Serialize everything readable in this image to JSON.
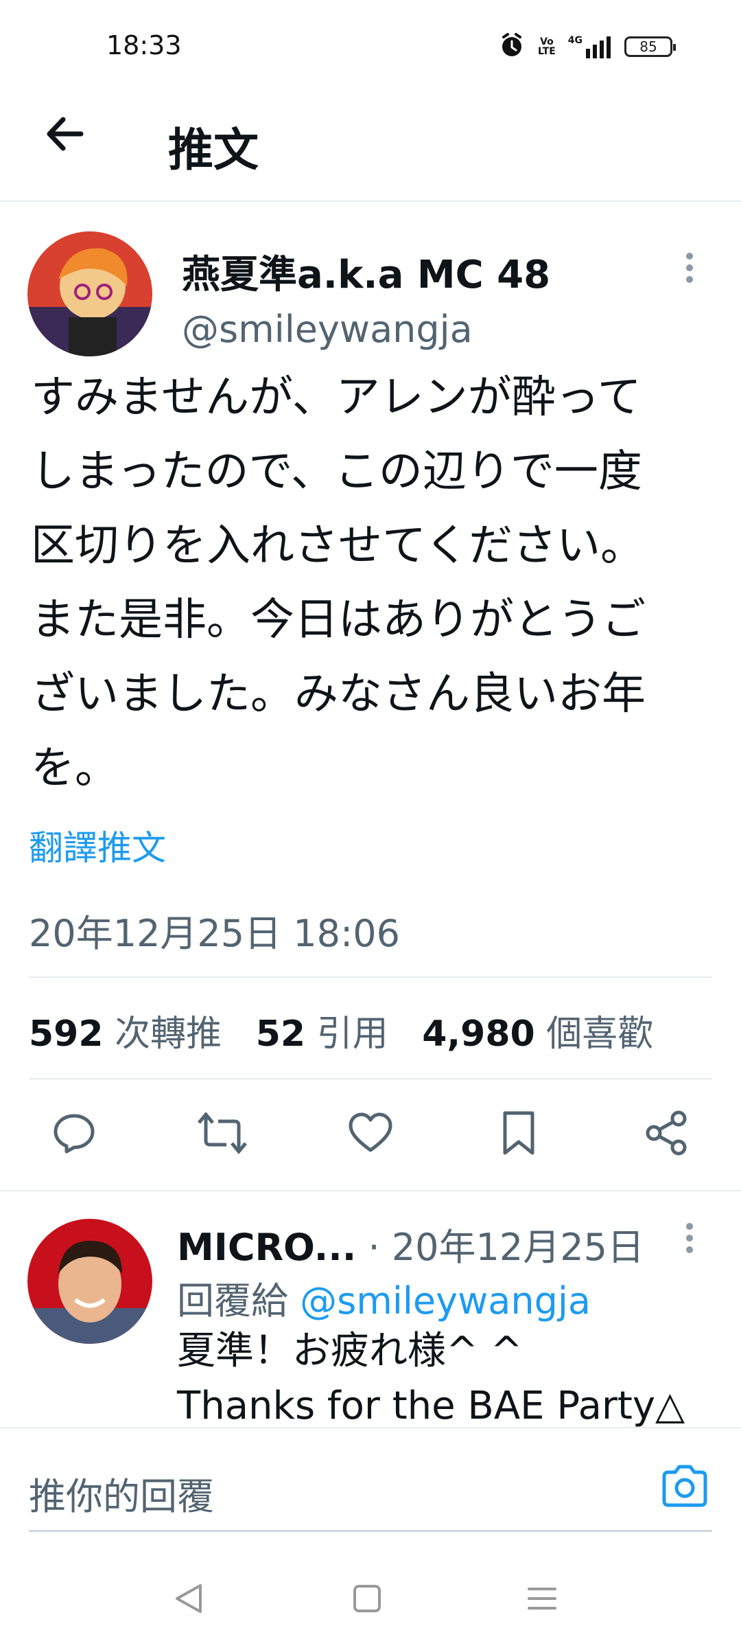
{
  "status_bar": {
    "time": "18:33",
    "battery": "85",
    "network": "4G",
    "volte_top": "Vo",
    "volte_bottom": "LTE"
  },
  "header": {
    "title": "推文"
  },
  "tweet": {
    "author_name": "燕夏準a.k.a MC 48",
    "handle": "@smileywangja",
    "text_lines": [
      "すみませんが、アレンが酔って",
      "しまったので、この辺りで一度",
      "区切りを入れさせてください。",
      "また是非。今日はありがとうご",
      "ざいました。みなさん良いお年",
      "を。"
    ],
    "translate_link": "翻譯推文",
    "timestamp": "20年12月25日 18:06",
    "stats": {
      "retweets_count": "592",
      "retweets_label": "次轉推",
      "quotes_count": "52",
      "quotes_label": "引用",
      "likes_count": "4,980",
      "likes_label": "個喜歡"
    }
  },
  "reply": {
    "author_name": "MICRO...",
    "date": "· 20年12月25日",
    "replying_to_label": "回覆給",
    "replying_to_handle": "@smileywangja",
    "text_lines": [
      "夏準！お疲れ様^ ^",
      "Thanks for the BAE Party△"
    ]
  },
  "composer": {
    "placeholder": "推你的回覆"
  },
  "colors": {
    "accent": "#1d9bf0",
    "text": "#0f1419",
    "muted": "#536471",
    "divider": "#e6ecf0"
  },
  "icons": [
    "back-arrow-icon",
    "more-icon",
    "reply-icon",
    "retweet-icon",
    "like-icon",
    "bookmark-icon",
    "share-icon",
    "camera-icon",
    "nav-back-icon",
    "nav-home-icon",
    "nav-menu-icon"
  ]
}
